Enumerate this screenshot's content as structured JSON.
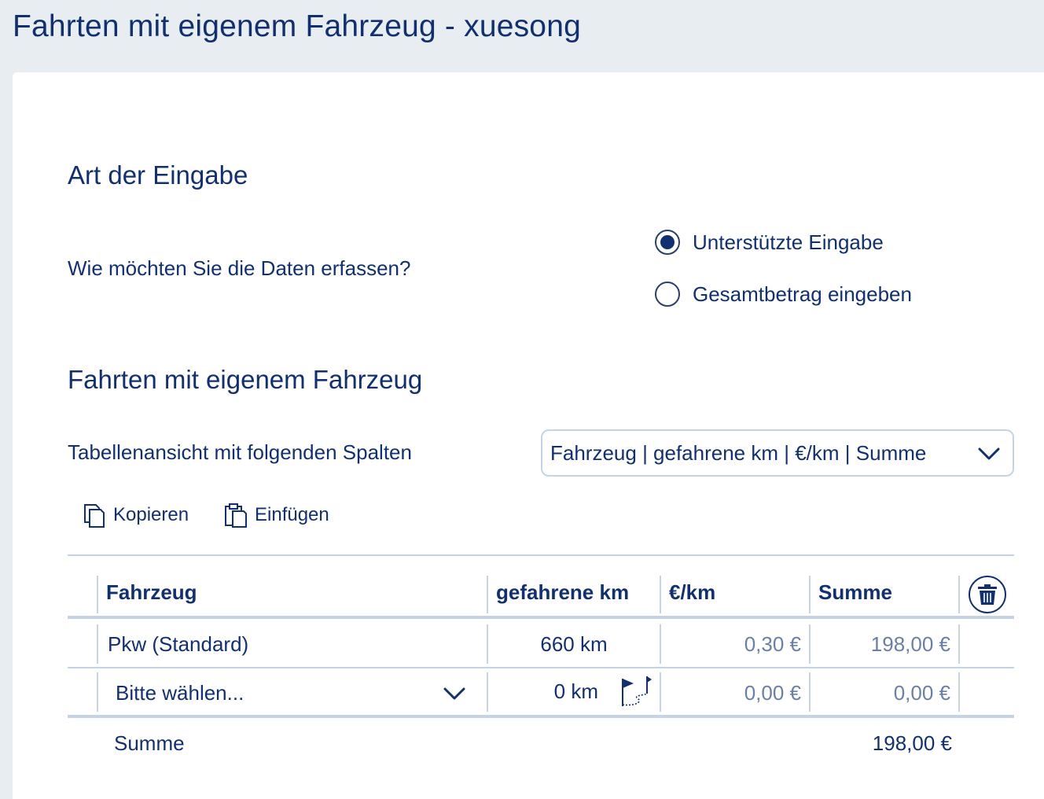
{
  "window": {
    "title": "Fahrten mit eigenem Fahrzeug - xuesong"
  },
  "section_input": {
    "title": "Art der Eingabe",
    "question": "Wie möchten Sie die Daten erfassen?",
    "options": [
      {
        "label": "Unterstützte Eingabe",
        "selected": true
      },
      {
        "label": "Gesamtbetrag eingeben",
        "selected": false
      }
    ]
  },
  "section_trips": {
    "title": "Fahrten mit eigenem Fahrzeug",
    "view_label": "Tabellenansicht mit folgenden Spalten",
    "view_value": "Fahrzeug | gefahrene km | €/km | Summe"
  },
  "toolbar": {
    "copy_label": "Kopieren",
    "paste_label": "Einfügen"
  },
  "table": {
    "headers": {
      "vehicle": "Fahrzeug",
      "km": "gefahrene km",
      "rate": "€/km",
      "sum": "Summe"
    },
    "rows": [
      {
        "vehicle": "Pkw (Standard)",
        "km": "660 km",
        "rate": "0,30 €",
        "sum": "198,00 €"
      },
      {
        "vehicle": "Bitte wählen...",
        "km": "0 km",
        "rate": "0,00 €",
        "sum": "0,00 €"
      }
    ],
    "footer": {
      "label": "Summe",
      "total": "198,00 €"
    }
  },
  "icons": {
    "radio": "radio-icon",
    "select_chevron": "chevron-down-icon",
    "copy": "copy-icon",
    "paste": "paste-icon",
    "delete": "trash-icon",
    "route": "route-flag-icon"
  },
  "colors": {
    "primary": "#12306e",
    "muted": "#6b7fa6",
    "border": "#c6d3e3",
    "background": "#e8edf2"
  }
}
